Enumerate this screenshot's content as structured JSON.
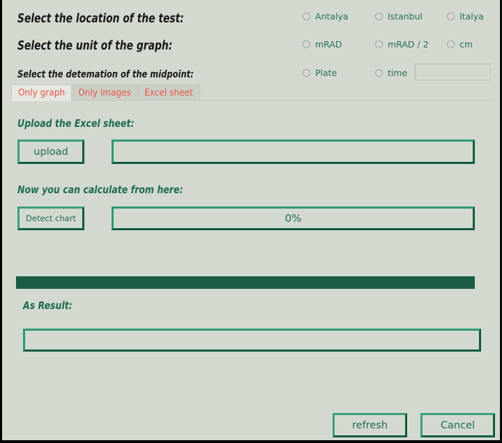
{
  "theme": {
    "background": "#d4d9cf",
    "accent_green": "#1d6b52",
    "bevel_light": "#3aa07a",
    "bevel_dark": "#0f5c40",
    "divider_green": "#1a5c44",
    "tab_text_red": "#e8544b",
    "heading_black": "#16181a"
  },
  "form": {
    "rows": [
      {
        "label": "Select the location of the test:",
        "options": [
          "Antalya",
          "Istanbul",
          "Italya"
        ]
      },
      {
        "label": "Select the unit of the graph:",
        "options": [
          "mRAD",
          "mRAD / 2",
          "cm"
        ]
      },
      {
        "label": "Select the detemation of the midpoint:",
        "options": [
          "Plate",
          "time"
        ],
        "time_value": "",
        "time_placeholder": ""
      }
    ]
  },
  "tabs": [
    {
      "label": "Only graph",
      "active": true
    },
    {
      "label": "Only images",
      "active": false
    },
    {
      "label": "Excel sheet",
      "active": false
    }
  ],
  "panel": {
    "upload_section_label": "Upload the Excel sheet:",
    "upload_button": "upload",
    "upload_path_value": "",
    "upload_path_placeholder": "",
    "calculate_section_label": "Now you can calculate from here:",
    "detect_button": "Detect chart",
    "progress_text": "0%",
    "progress_percent": 0,
    "result_label": "As Result:",
    "result_value": "",
    "result_placeholder": ""
  },
  "footer": {
    "refresh_button": "refresh",
    "cancel_button": "Cancel"
  }
}
